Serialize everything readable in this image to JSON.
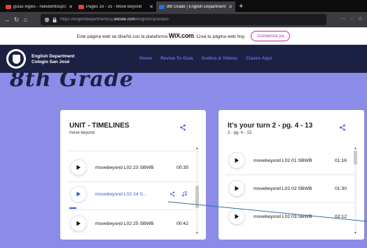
{
  "browser": {
    "tabs": [
      {
        "title": "guías inglés - nekidehttocp0:",
        "favicon_color": "#e0463b",
        "active": false
      },
      {
        "title": "Pages 16 - 25 - Move Beyond",
        "favicon_color": "#e0463b",
        "active": false
      },
      {
        "title": "8th Grade | English Department",
        "favicon_color": "#2b6fd8",
        "active": true
      }
    ],
    "url_prefix": "https://englishdepartmentcsj.",
    "url_domain": "wixsite.com",
    "url_path": "/englishcsj/octavo"
  },
  "banner": {
    "text_before": "Este página web se diseñó con la plataforma",
    "wix": "WiX.com",
    "text_after": ". Crea tu página web hoy.",
    "cta": "Comienza ya"
  },
  "site": {
    "brand_line1": "English Department",
    "brand_line2": "Colegio San José",
    "nav": [
      "Home",
      "Revisa Tu Guía",
      "Audios & Videos",
      "Clases Aquí"
    ],
    "big_title": "8th Grade"
  },
  "playlists": [
    {
      "title": "UNIT - TIMELINES",
      "subtitle": "move beyond",
      "tracks": [
        {
          "name": "movebeyond L02 23 SBWB",
          "duration": "00:35",
          "active": false
        },
        {
          "name": "movebeyond L02 24 S...",
          "duration": "",
          "active": true
        },
        {
          "name": "movebeyond L02 25 SBWB",
          "duration": "00:42",
          "active": false
        }
      ]
    },
    {
      "title": "It's your turn 2 - pg. 4 - 13",
      "subtitle": "2 - pg. 4 - 13",
      "tracks": [
        {
          "name": "movebeyond L02 01 SBWB",
          "duration": "01:16",
          "active": false
        },
        {
          "name": "movebeyond L02 02 SBWB",
          "duration": "01:30",
          "active": false
        },
        {
          "name": "movebeyond L02 03 SBWB",
          "duration": "02:12",
          "active": false
        }
      ]
    }
  ],
  "playback_progress": 0.05,
  "colors": {
    "page_bg": "#8b8be8",
    "header_bg": "#1c2143",
    "accent": "#3a57d6",
    "wix_cta": "#b92fa8"
  }
}
